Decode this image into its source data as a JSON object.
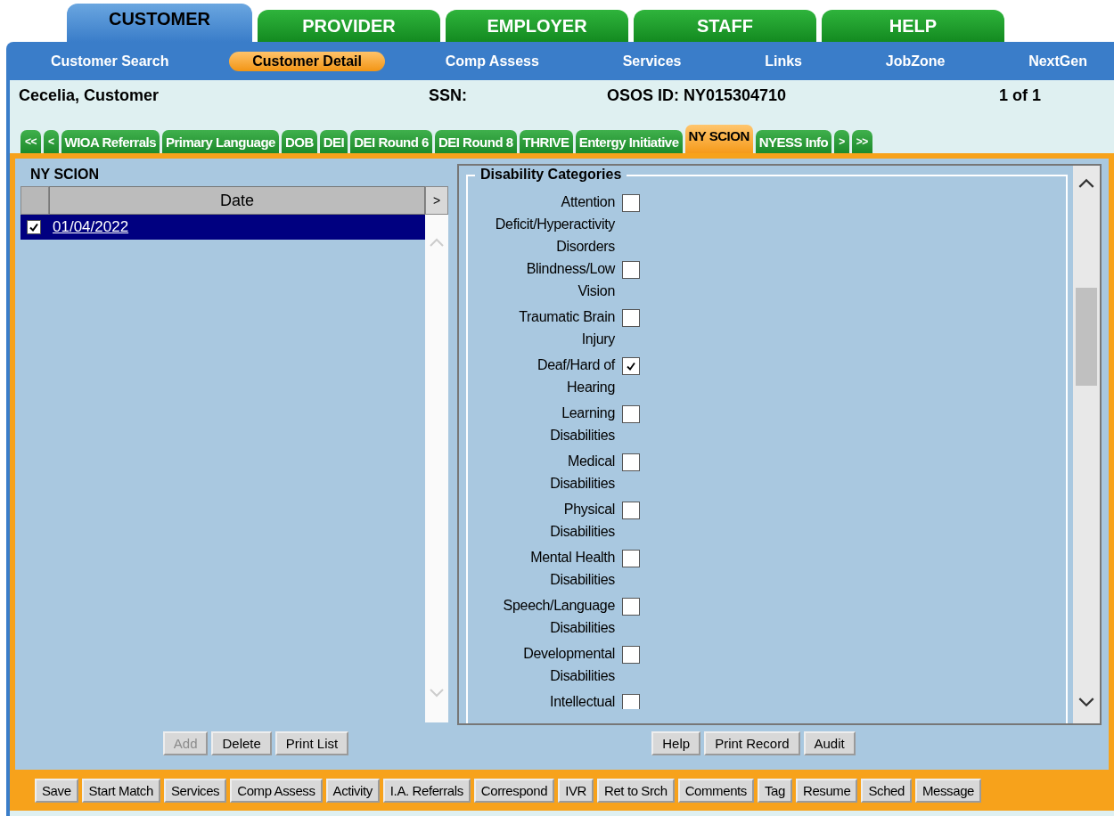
{
  "top_tabs": [
    {
      "label": "CUSTOMER",
      "selected": true
    },
    {
      "label": "PROVIDER",
      "selected": false
    },
    {
      "label": "EMPLOYER",
      "selected": false
    },
    {
      "label": "STAFF",
      "selected": false
    },
    {
      "label": "HELP",
      "selected": false
    }
  ],
  "nav": [
    {
      "label": "Customer Search",
      "selected": false
    },
    {
      "label": "Customer Detail",
      "selected": true
    },
    {
      "label": "Comp Assess",
      "selected": false
    },
    {
      "label": "Services",
      "selected": false
    },
    {
      "label": "Links",
      "selected": false
    },
    {
      "label": "JobZone",
      "selected": false
    },
    {
      "label": "NextGen",
      "selected": false
    }
  ],
  "header": {
    "name": "Cecelia, Customer",
    "ssn_label": "SSN:",
    "osos_id": "OSOS ID: NY015304710",
    "record_count": "1 of 1"
  },
  "sub_tabs": [
    {
      "label": "<<",
      "kind": "arrow",
      "selected": false
    },
    {
      "label": "<",
      "kind": "arrow",
      "selected": false
    },
    {
      "label": "WIOA Referrals",
      "kind": "tab",
      "selected": false
    },
    {
      "label": "Primary Language",
      "kind": "tab",
      "selected": false
    },
    {
      "label": "DOB",
      "kind": "tab",
      "selected": false
    },
    {
      "label": "DEI",
      "kind": "tab",
      "selected": false
    },
    {
      "label": "DEI Round 6",
      "kind": "tab",
      "selected": false
    },
    {
      "label": "DEI Round 8",
      "kind": "tab",
      "selected": false
    },
    {
      "label": "THRIVE",
      "kind": "tab",
      "selected": false
    },
    {
      "label": "Entergy Initiative",
      "kind": "tab",
      "selected": false
    },
    {
      "label": "NY SCION",
      "kind": "tab",
      "selected": true
    },
    {
      "label": "NYESS Info",
      "kind": "tab",
      "selected": false
    },
    {
      "label": ">",
      "kind": "arrow",
      "selected": false
    },
    {
      "label": ">>",
      "kind": "arrow",
      "selected": false
    }
  ],
  "left_panel": {
    "title": "NY SCION",
    "column": "Date",
    "column_button": ">",
    "rows": [
      {
        "checked": true,
        "date": "01/04/2022",
        "selected": true
      }
    ],
    "buttons": [
      {
        "label": "Add",
        "disabled": true
      },
      {
        "label": "Delete",
        "disabled": false
      },
      {
        "label": "Print List",
        "disabled": false
      }
    ]
  },
  "right_panel": {
    "legend": "Disability Categories",
    "items": [
      {
        "label": "Attention\nDeficit/Hyperactivity\nDisorders",
        "checked": false
      },
      {
        "label": "Blindness/Low\nVision",
        "checked": false
      },
      {
        "label": "Traumatic Brain\nInjury",
        "checked": false
      },
      {
        "label": "Deaf/Hard of\nHearing",
        "checked": true
      },
      {
        "label": "Learning\nDisabilities",
        "checked": false
      },
      {
        "label": "Medical\nDisabilities",
        "checked": false
      },
      {
        "label": "Physical\nDisabilities",
        "checked": false
      },
      {
        "label": "Mental Health\nDisabilities",
        "checked": false
      },
      {
        "label": "Speech/Language\nDisabilities",
        "checked": false
      },
      {
        "label": "Developmental\nDisabilities",
        "checked": false
      },
      {
        "label": "Intellectual",
        "checked": false
      }
    ],
    "buttons": [
      {
        "label": "Help",
        "disabled": false
      },
      {
        "label": "Print Record",
        "disabled": false
      },
      {
        "label": "Audit",
        "disabled": false
      }
    ]
  },
  "bottom_buttons": [
    "Save",
    "Start Match",
    "Services",
    "Comp Assess",
    "Activity",
    "I.A. Referrals",
    "Correspond",
    "IVR",
    "Ret to Srch",
    "Comments",
    "Tag",
    "Resume",
    "Sched",
    "Message"
  ]
}
